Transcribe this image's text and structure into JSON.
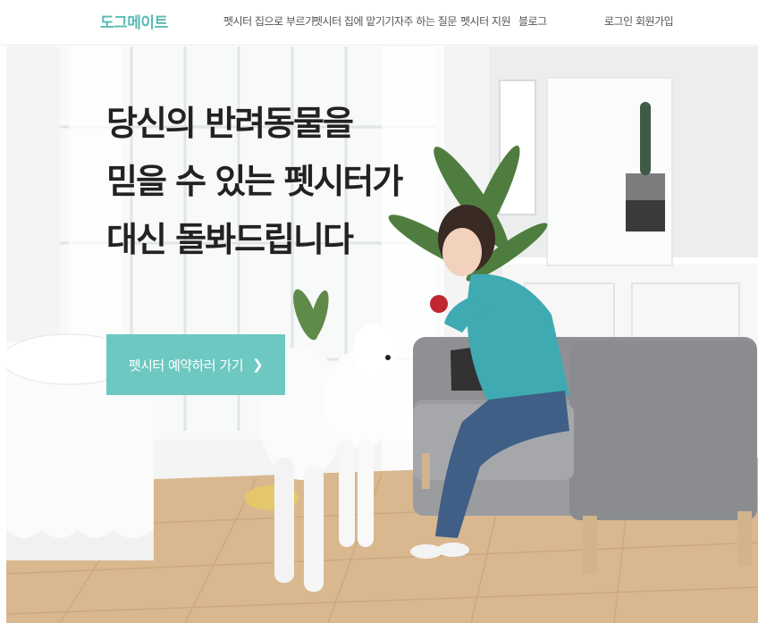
{
  "header": {
    "logo": "도그메이트",
    "menu": [
      "펫시터 집으로 부르기",
      "펫시터 집에 맡기기",
      "자주 하는 질문",
      "펫시터 지원",
      "블로그"
    ],
    "login": "로그인",
    "signup": "회원가입"
  },
  "hero": {
    "headline": [
      "당신의 반려동물을",
      "믿을 수 있는 펫시터가",
      "대신 돌봐드립니다"
    ],
    "cta_label": "펫시터 예약하러 가기",
    "cta_icon": "chevron-right-icon",
    "accent_color": "#6cc8c1"
  }
}
